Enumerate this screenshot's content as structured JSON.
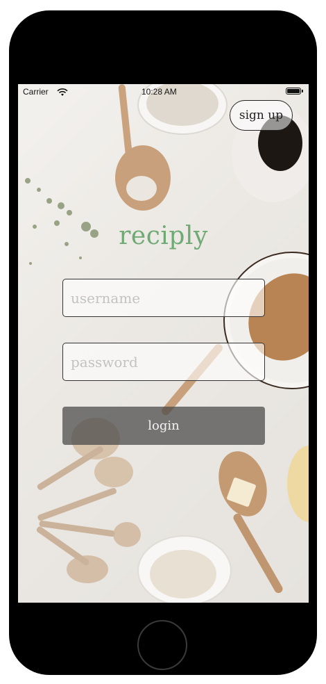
{
  "status_bar": {
    "carrier": "Carrier",
    "time": "10:28 AM"
  },
  "header": {
    "signup_label": "sign up"
  },
  "app": {
    "title": "reciply"
  },
  "form": {
    "username_placeholder": "username",
    "password_placeholder": "password",
    "login_label": "login"
  },
  "colors": {
    "brand_green": "#6faa74",
    "device_frame": "#000000"
  }
}
